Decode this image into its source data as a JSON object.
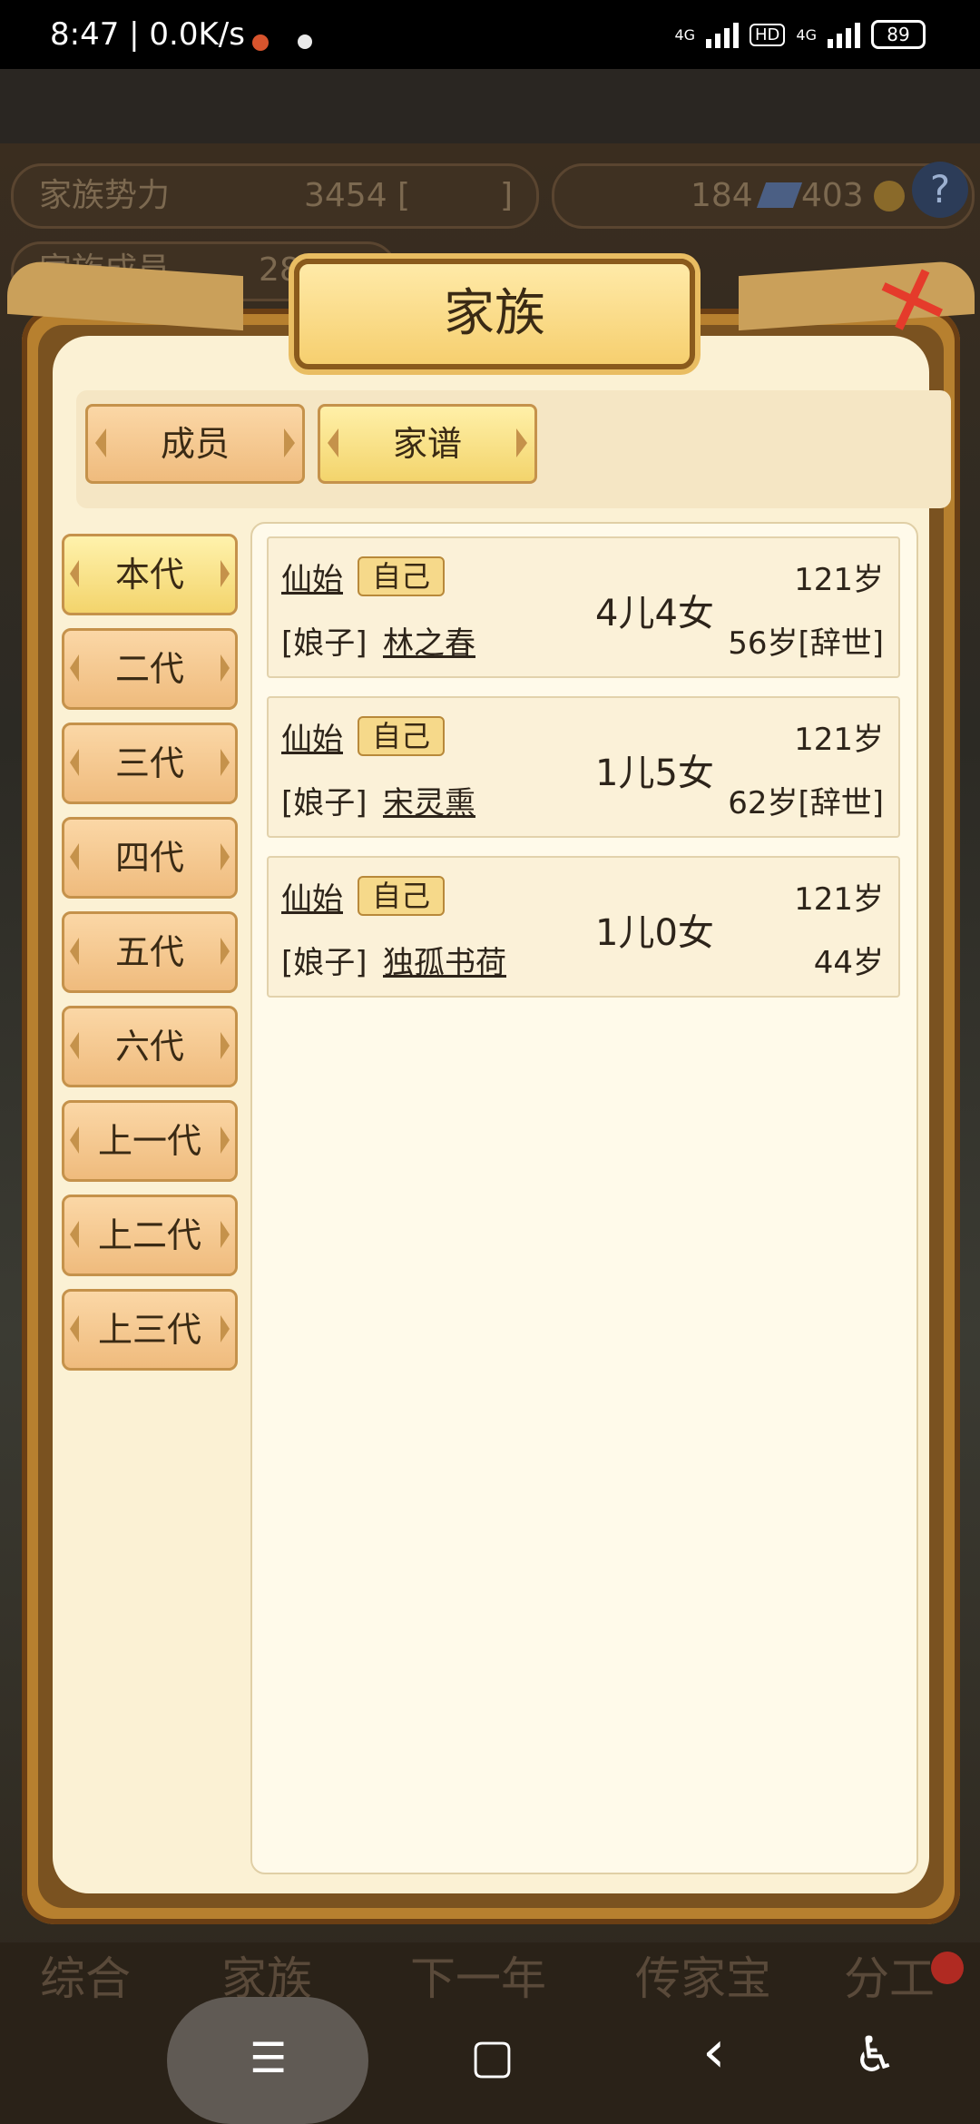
{
  "status_bar": {
    "time": "8:47 | 0.0K/s",
    "network_1": "4G",
    "hd": "HD",
    "network_2": "4G",
    "battery": "89"
  },
  "background": {
    "clan_power_label": "家族势力",
    "clan_power_value": "3454 [",
    "clan_power_suffix": "]",
    "resource_a": "184",
    "resource_b": "403",
    "members_label": "家族成员",
    "members_value": "28",
    "help": "?"
  },
  "dialog": {
    "title": "家族",
    "close_glyph": "✕"
  },
  "tabs": [
    {
      "label": "成员",
      "active": false
    },
    {
      "label": "家谱",
      "active": true
    }
  ],
  "generations": [
    {
      "label": "本代",
      "active": true
    },
    {
      "label": "二代",
      "active": false
    },
    {
      "label": "三代",
      "active": false
    },
    {
      "label": "四代",
      "active": false
    },
    {
      "label": "五代",
      "active": false
    },
    {
      "label": "六代",
      "active": false
    },
    {
      "label": "上一代",
      "active": false
    },
    {
      "label": "上二代",
      "active": false
    },
    {
      "label": "上三代",
      "active": false
    }
  ],
  "records": [
    {
      "name": "仙始",
      "badge": "自己",
      "spouse_prefix": "[娘子]",
      "spouse": "林之春",
      "children": "4儿4女",
      "age": "121岁",
      "spouse_age": "56岁[辞世]"
    },
    {
      "name": "仙始",
      "badge": "自己",
      "spouse_prefix": "[娘子]",
      "spouse": "宋灵熏",
      "children": "1儿5女",
      "age": "121岁",
      "spouse_age": "62岁[辞世]"
    },
    {
      "name": "仙始",
      "badge": "自己",
      "spouse_prefix": "[娘子]",
      "spouse": "独孤书荷",
      "children": "1儿0女",
      "age": "121岁",
      "spouse_age": "44岁"
    }
  ],
  "bottom_nav": {
    "labels": [
      "综合",
      "家族",
      "下一年",
      "传家宝",
      "分工"
    ]
  },
  "system_nav": {
    "menu": "☰",
    "home": "▢",
    "back": "‹",
    "accessibility": "♿"
  }
}
